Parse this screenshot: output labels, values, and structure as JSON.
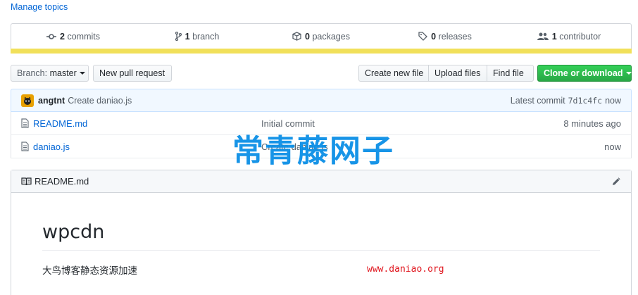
{
  "topics": {
    "manage_label": "Manage topics"
  },
  "numbers_summary": {
    "commits": {
      "count": "2",
      "label": "commits"
    },
    "branches": {
      "count": "1",
      "label": "branch"
    },
    "packages": {
      "count": "0",
      "label": "packages"
    },
    "releases": {
      "count": "0",
      "label": "releases"
    },
    "contributors": {
      "count": "1",
      "label": "contributor"
    },
    "language_bar_color": "#f1e05a"
  },
  "toolbar": {
    "branch_prefix": "Branch:",
    "branch_name": "master",
    "new_pull_request": "New pull request",
    "create_new_file": "Create new file",
    "upload_files": "Upload files",
    "find_file": "Find file",
    "clone_or_download": "Clone or download"
  },
  "latest_commit": {
    "author": "angtnt",
    "message": "Create daniao.js",
    "prefix": "Latest commit",
    "sha": "7d1c4fc",
    "age": "now"
  },
  "files": [
    {
      "name": "README.md",
      "message": "Initial commit",
      "age": "8 minutes ago"
    },
    {
      "name": "daniao.js",
      "message": "Create daniao.js",
      "age": "now"
    }
  ],
  "watermark_text": "常青藤网子",
  "readme": {
    "header_title": "README.md",
    "heading": "wpcdn",
    "paragraph": "大鸟博客静态资源加速",
    "link_text": "www.daniao.org"
  }
}
